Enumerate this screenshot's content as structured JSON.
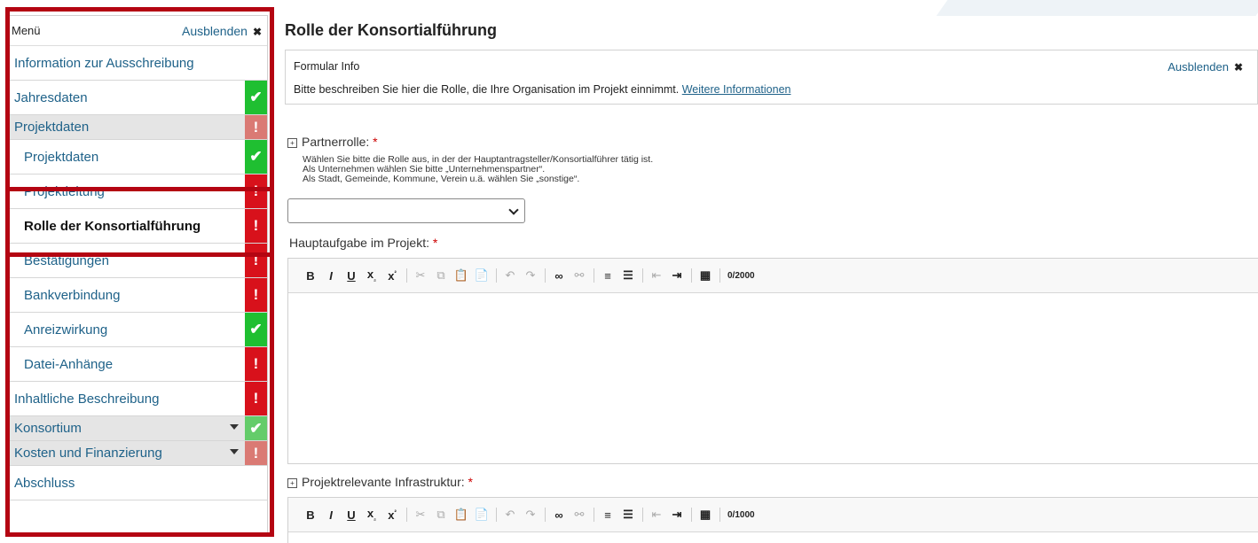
{
  "menu": {
    "label": "Menü",
    "hide_label": "Ausblenden",
    "hide_icon": "close-icon",
    "items": [
      {
        "label": "Information zur Ausschreibung",
        "level": "top",
        "status": "none"
      },
      {
        "label": "Jahresdaten",
        "level": "top",
        "status": "ok"
      },
      {
        "label": "Projektdaten",
        "level": "group",
        "status": "error"
      },
      {
        "label": "Projektdaten",
        "level": "sub",
        "status": "ok"
      },
      {
        "label": "Projektleitung",
        "level": "sub",
        "status": "error"
      },
      {
        "label": "Rolle der Konsortialführung",
        "level": "sub",
        "status": "error",
        "active": true
      },
      {
        "label": "Bestätigungen",
        "level": "sub",
        "status": "error"
      },
      {
        "label": "Bankverbindung",
        "level": "sub",
        "status": "error"
      },
      {
        "label": "Anreizwirkung",
        "level": "sub",
        "status": "ok"
      },
      {
        "label": "Datei-Anhänge",
        "level": "sub",
        "status": "error"
      },
      {
        "label": "Inhaltliche Beschreibung",
        "level": "top",
        "status": "error"
      },
      {
        "label": "Konsortium",
        "level": "group",
        "status": "ok",
        "collapsible": true
      },
      {
        "label": "Kosten und Finanzierung",
        "level": "group",
        "status": "error",
        "collapsible": true
      },
      {
        "label": "Abschluss",
        "level": "top",
        "status": "none"
      }
    ]
  },
  "page": {
    "title": "Rolle der Konsortialführung"
  },
  "info": {
    "heading": "Formular Info",
    "hide_label": "Ausblenden",
    "text": "Bitte beschreiben Sie hier die Rolle, die Ihre Organisation im Projekt einnimmt.",
    "link": "Weitere Informationen"
  },
  "fields": {
    "partnerrolle": {
      "label": "Partnerrolle:",
      "required": "*",
      "hint_lines": [
        "Wählen Sie bitte die Rolle aus, in der der Hauptantragsteller/Konsortialführer tätig ist.",
        "Als Unternehmen wählen Sie bitte „Unternehmenspartner“.",
        "Als Stadt, Gemeinde, Kommune, Verein u.ä. wählen Sie „sonstige“."
      ],
      "selected_value": ""
    },
    "hauptaufgabe": {
      "label": "Hauptaufgabe im Projekt:",
      "required": "*",
      "counter": "0/2000"
    },
    "infrastruktur": {
      "label": "Projektrelevante Infrastruktur:",
      "required": "*",
      "counter": "0/1000"
    }
  },
  "toolbar_buttons": [
    "bold",
    "italic",
    "underline",
    "subscript",
    "superscript",
    "cut",
    "copy",
    "paste",
    "paste-text",
    "undo",
    "redo",
    "link",
    "unlink",
    "numbered-list",
    "bulleted-list",
    "outdent",
    "indent",
    "table"
  ],
  "colors": {
    "ok": "#1fbf31",
    "error": "#d8111b",
    "link": "#1f6289",
    "annotation": "#b40512"
  }
}
